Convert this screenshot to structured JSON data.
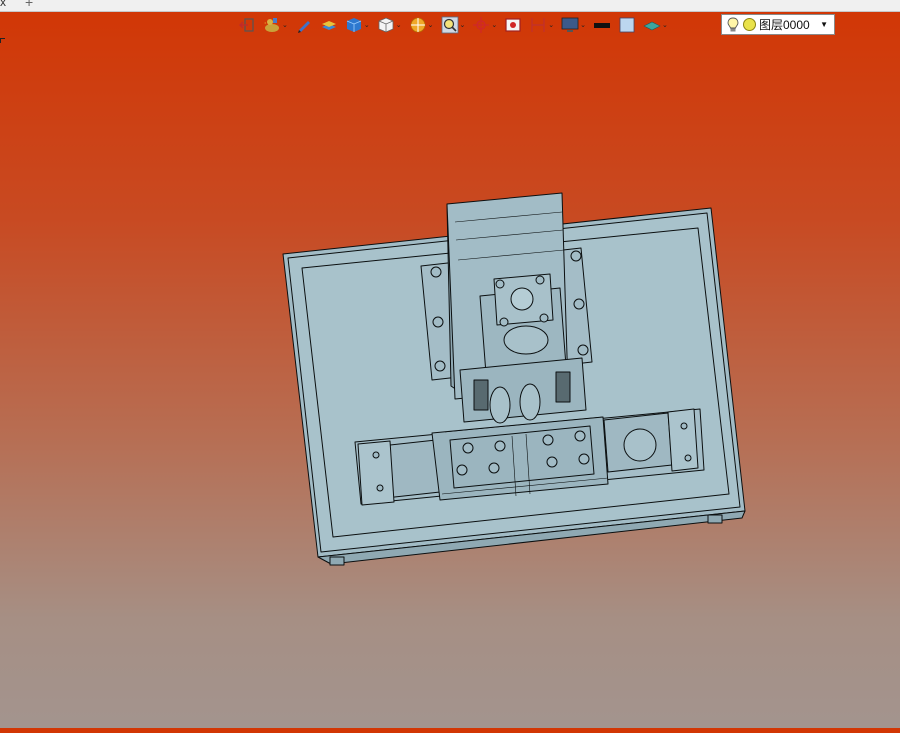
{
  "tabs": {
    "close_glyph": "x",
    "add_glyph": "+"
  },
  "toolbar": {
    "buttons": [
      {
        "icon": "exit-view-icon",
        "has_dropdown": false
      },
      {
        "icon": "duck-render-icon",
        "has_dropdown": true
      },
      {
        "icon": "pen-sketch-icon",
        "has_dropdown": false
      },
      {
        "icon": "layer-stack-icon",
        "has_dropdown": false
      },
      {
        "icon": "cube-display-icon",
        "has_dropdown": true
      },
      {
        "icon": "view-orientation-cube-icon",
        "has_dropdown": true
      },
      {
        "icon": "section-view-icon",
        "has_dropdown": true
      },
      {
        "icon": "zoom-view-icon",
        "has_dropdown": true
      },
      {
        "icon": "origin-target-icon",
        "has_dropdown": true
      },
      {
        "icon": "camera-record-icon",
        "has_dropdown": false
      },
      {
        "icon": "dimension-icon",
        "has_dropdown": true
      },
      {
        "icon": "monitor-display-icon",
        "has_dropdown": true
      },
      {
        "icon": "line-color-icon",
        "has_dropdown": false
      },
      {
        "icon": "fill-color-icon",
        "has_dropdown": false
      },
      {
        "icon": "plane-layer-icon",
        "has_dropdown": true
      }
    ],
    "layer": {
      "label": "图层0000",
      "dot_color": "#e9e24a"
    }
  },
  "colors": {
    "bg_top": "#d23604",
    "bg_bottom": "#a3948e",
    "part_fill": "#a2bcc6",
    "line": "#0b0f10"
  }
}
